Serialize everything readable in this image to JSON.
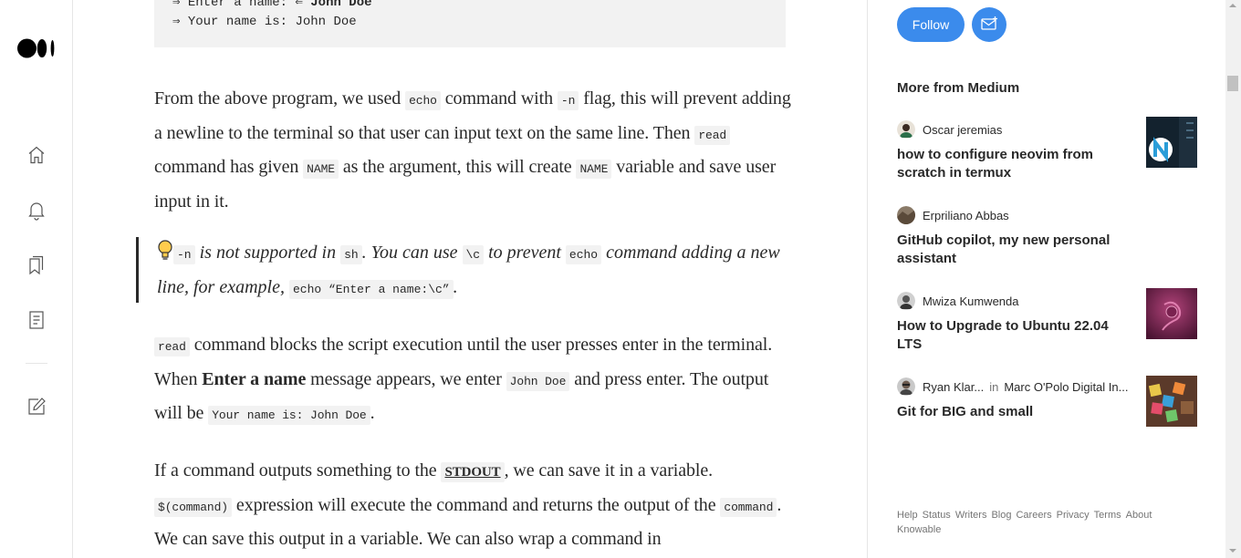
{
  "code_block": {
    "line1_prefix": "⇒ Enter a name: ⇐ ",
    "line1_bold": "John Doe",
    "line2": "⇒ Your name is: John Doe"
  },
  "para1": {
    "t1": "From the above program, we used ",
    "c1": "echo",
    "t2": " command with ",
    "c2": "-n",
    "t3": " flag, this will prevent adding a newline to the terminal so that user can input text on the same line. Then ",
    "c3": "read",
    "t4": " command has given ",
    "c4": "NAME",
    "t5": " as the argument, this will create ",
    "c5": "NAME",
    "t6": " variable and save user input in it."
  },
  "quote": {
    "c1": "-n",
    "t1": " is not supported in ",
    "c2": "sh",
    "t2": ". You can use ",
    "c3": "\\c",
    "t3": " to prevent ",
    "c4": "echo",
    "t4": " command adding a new line, for example, ",
    "c5": "echo “Enter a name:\\c”",
    "t5": "."
  },
  "para2": {
    "c1": "read",
    "t1": " command blocks the script execution until the user presses enter in the terminal. When ",
    "b1": "Enter a name",
    "t2": " message appears, we enter ",
    "c2": "John Doe",
    "t3": " and press enter. The output will be ",
    "c3": "Your name is: John Doe",
    "t4": "."
  },
  "para3": {
    "t1": "If a command outputs something to the ",
    "link1": "STDOUT",
    "t2": ", we can save it in a variable. ",
    "c1": "$(command)",
    "t3": " expression will execute the command and returns the output of the ",
    "c2": "command",
    "t4": ". We can save this output in a variable. We can also wrap a command in"
  },
  "sidebar": {
    "follow_label": "Follow",
    "more_heading": "More from Medium",
    "stories": [
      {
        "author": "Oscar jeremias",
        "publication": "",
        "in": "",
        "title": "how to configure neovim from scratch in termux"
      },
      {
        "author": "Erpriliano Abbas",
        "publication": "",
        "in": "",
        "title": "GitHub copilot, my new personal assistant"
      },
      {
        "author": "Mwiza Kumwenda",
        "publication": "",
        "in": "",
        "title": "How to Upgrade to Ubuntu 22.04 LTS"
      },
      {
        "author": "Ryan Klar...",
        "in": "in",
        "publication": "Marc O'Polo Digital In...",
        "title": "Git for BIG and small"
      }
    ],
    "footer_links": [
      "Help",
      "Status",
      "Writers",
      "Blog",
      "Careers",
      "Privacy",
      "Terms",
      "About",
      "Knowable"
    ]
  },
  "colors": {
    "accent": "#3b8bec",
    "text": "#292929",
    "muted": "#757575",
    "code_bg": "#f2f2f2"
  },
  "icons": [
    "medium-logo-icon",
    "home-icon",
    "bell-icon",
    "bookmarks-icon",
    "stories-icon",
    "write-icon",
    "subscribe-mail-icon",
    "lightbulb-icon"
  ]
}
